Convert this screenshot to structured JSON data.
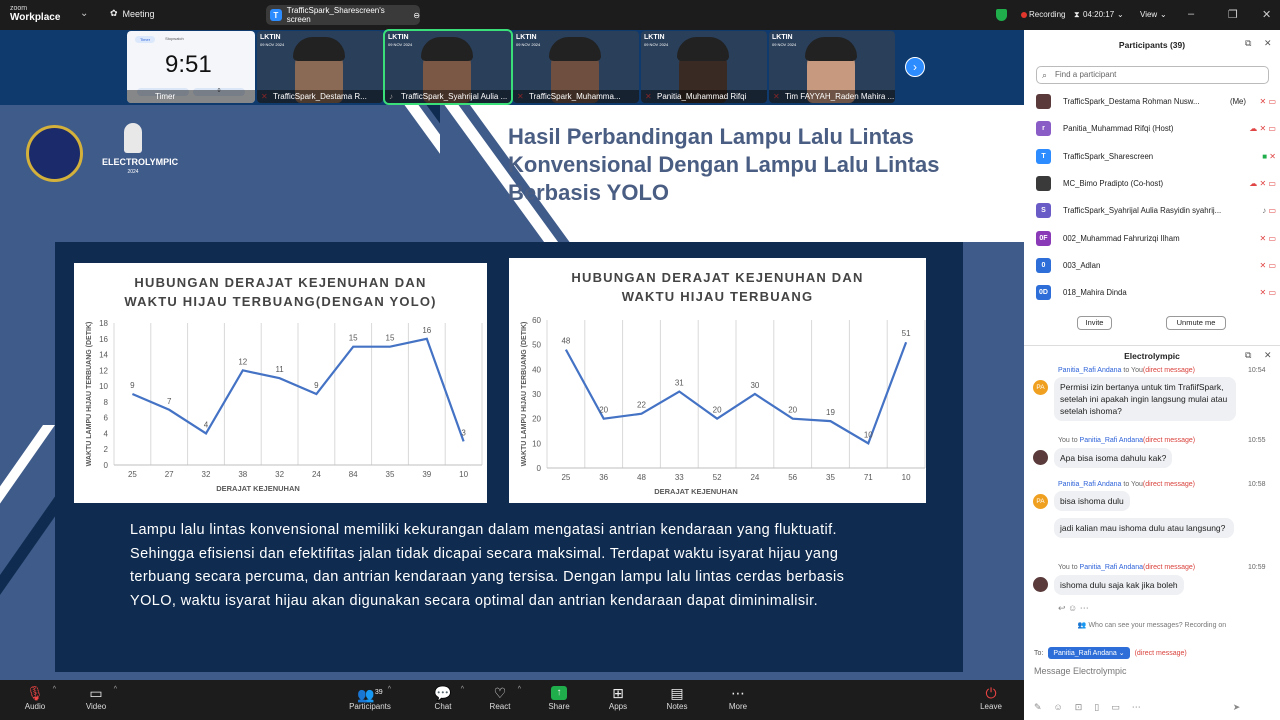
{
  "topbar": {
    "logo_line1": "zoom",
    "logo_line2": "Workplace",
    "meeting_label": "Meeting",
    "share_chip_label": "TrafficSpark_Sharescreen's screen",
    "recording_label": "Recording",
    "elapsed": "04:20:17",
    "view_label": "View"
  },
  "video_strip": {
    "timer_tile": {
      "tab1": "Timer",
      "tab2": "Stopwatch",
      "time": "9:51",
      "name": "Timer",
      "button_value": "0"
    },
    "tiles": [
      {
        "name": "TrafficSpark_Destama R...",
        "badge": "LKTIN",
        "date": "09 NOV 2024"
      },
      {
        "name": "TrafficSpark_Syahrijal Aulia ...",
        "badge": "LKTIN",
        "date": "09 NOV 2024"
      },
      {
        "name": "TrafficSpark_Muhamma...",
        "badge": "LKTIN",
        "date": "09 NOV 2024"
      },
      {
        "name": "Panitia_Muhammad Rifqi",
        "badge": "LKTIN",
        "date": "09 NOV 2024"
      },
      {
        "name": "Tim FAYYAH_Raden Mahira ...",
        "badge": "LKTIN",
        "date": "09 NOV 2024"
      }
    ]
  },
  "slide": {
    "logo_text": "ELECTROLYMPIC",
    "logo_year": "2024",
    "title_line1": "Hasil Perbandingan Lampu Lalu Lintas",
    "title_line2": "Konvensional Dengan Lampu Lalu Lintas",
    "title_line3": "Berbasis YOLO",
    "body": "Lampu lalu lintas konvensional memiliki kekurangan dalam mengatasi antrian kendaraan yang fluktuatif. Sehingga efisiensi dan efektifitas jalan tidak dicapai secara maksimal. Terdapat waktu isyarat hijau yang terbuang secara percuma, dan antrian kendaraan yang tersisa. Dengan lampu lalu lintas cerdas berbasis YOLO, waktu isyarat hijau akan digunakan secara optimal dan antrian kendaraan dapat diminimalisir."
  },
  "chart_data": [
    {
      "type": "line",
      "title": "HUBUNGAN DERAJAT KEJENUHAN DAN WAKTU HIJAU TERBUANG(DENGAN YOLO)",
      "title_line1": "HUBUNGAN DERAJAT KEJENUHAN DAN",
      "title_line2": "WAKTU HIJAU TERBUANG(DENGAN YOLO)",
      "xlabel": "DERAJAT KEJENUHAN",
      "ylabel": "WAKTU LAMPU HIJAU TERBUANG (DETIK)",
      "ylim": [
        0,
        18
      ],
      "yticks": [
        0,
        2,
        4,
        6,
        8,
        10,
        12,
        14,
        16,
        18
      ],
      "categories": [
        "25",
        "27",
        "32",
        "38",
        "32",
        "24",
        "84",
        "35",
        "39",
        "10"
      ],
      "values": [
        9,
        7,
        4,
        12,
        11,
        9,
        15,
        15,
        16,
        3
      ],
      "color": "#4472c4"
    },
    {
      "type": "line",
      "title": "HUBUNGAN DERAJAT KEJENUHAN DAN WAKTU HIJAU TERBUANG",
      "title_line1": "HUBUNGAN DERAJAT KEJENUHAN DAN",
      "title_line2": "WAKTU HIJAU TERBUANG",
      "xlabel": "DERAJAT KEJENUHAN",
      "ylabel": "WAKTU LAMPU HIJAU TERBUANG (DETIK)",
      "ylim": [
        0,
        60
      ],
      "yticks": [
        0,
        10,
        20,
        30,
        40,
        50,
        60
      ],
      "categories": [
        "25",
        "36",
        "48",
        "33",
        "52",
        "24",
        "56",
        "35",
        "71",
        "10"
      ],
      "values": [
        48,
        20,
        22,
        31,
        20,
        30,
        20,
        19,
        10,
        51
      ],
      "color": "#4472c4"
    }
  ],
  "bottom_bar": {
    "items": [
      {
        "label": "Audio",
        "icon": "mic-muted-icon"
      },
      {
        "label": "Video",
        "icon": "camera-icon"
      },
      {
        "label": "Participants",
        "icon": "people-icon",
        "count": "39"
      },
      {
        "label": "Chat",
        "icon": "chat-icon"
      },
      {
        "label": "React",
        "icon": "heart-icon"
      },
      {
        "label": "Share",
        "icon": "share-icon"
      },
      {
        "label": "Apps",
        "icon": "apps-icon"
      },
      {
        "label": "Notes",
        "icon": "notes-icon"
      },
      {
        "label": "More",
        "icon": "more-icon"
      },
      {
        "label": "Leave",
        "icon": "leave-icon"
      }
    ]
  },
  "participants": {
    "header": "Participants (39)",
    "search_placeholder": "Find a participant",
    "list": [
      {
        "name": "TrafficSpark_Destama Rohman Nusw...",
        "tag": "(Me)",
        "avatar": "",
        "color": "#5a3a3a"
      },
      {
        "name": "Panitia_Muhammad Rifqi (Host)",
        "tag": "",
        "avatar": "r",
        "color": "#8a5cc6"
      },
      {
        "name": "TrafficSpark_Sharescreen",
        "tag": "",
        "avatar": "T",
        "color": "#2d8cff"
      },
      {
        "name": "MC_Bimo Pradipto (Co-host)",
        "tag": "",
        "avatar": "",
        "color": "#3a3a3a"
      },
      {
        "name": "TrafficSpark_Syahrijal Aulia Rasyidin syahrij...",
        "tag": "",
        "avatar": "S",
        "color": "#6a5cc6"
      },
      {
        "name": "002_Muhammad Fahrurizqi Ilham",
        "tag": "",
        "avatar": "0F",
        "color": "#8a3ab6"
      },
      {
        "name": "003_Adlan",
        "tag": "",
        "avatar": "0",
        "color": "#2d6ed8"
      },
      {
        "name": "018_Mahira Dinda",
        "tag": "",
        "avatar": "0D",
        "color": "#2d6ed8"
      }
    ],
    "invite_label": "Invite",
    "unmute_label": "Unmute me"
  },
  "chat": {
    "header": "Electrolympic",
    "messages": [
      {
        "from": "Panitia_Rafi Andana",
        "to": "You",
        "dm": "(direct message)",
        "time": "10:54",
        "text": "Permisi izin bertanya untuk tim TrafiifSpark, setelah ini apakah ingin langsung mulai atau setelah ishoma?",
        "avatar": "PA"
      },
      {
        "from": "You",
        "to": "Panitia_Rafi Andana",
        "dm": "(direct message)",
        "time": "10:55",
        "text": "Apa bisa isoma dahulu kak?",
        "avatar": ""
      },
      {
        "from": "Panitia_Rafi Andana",
        "to": "You",
        "dm": "(direct message)",
        "time": "10:58",
        "text": "bisa ishoma dulu",
        "text2": "jadi kalian mau ishoma dulu atau langsung?",
        "avatar": "PA"
      },
      {
        "from": "You",
        "to": "Panitia_Rafi Andana",
        "dm": "(direct message)",
        "time": "10:59",
        "text": "ishoma dulu saja kak jika boleh",
        "avatar": ""
      }
    ],
    "who_can_see": "Who can see your messages? Recording on",
    "to_label": "To:",
    "to_recipient": "Panitia_Rafi Andana",
    "to_dm": "(direct message)",
    "input_placeholder": "Message Electrolympic"
  }
}
